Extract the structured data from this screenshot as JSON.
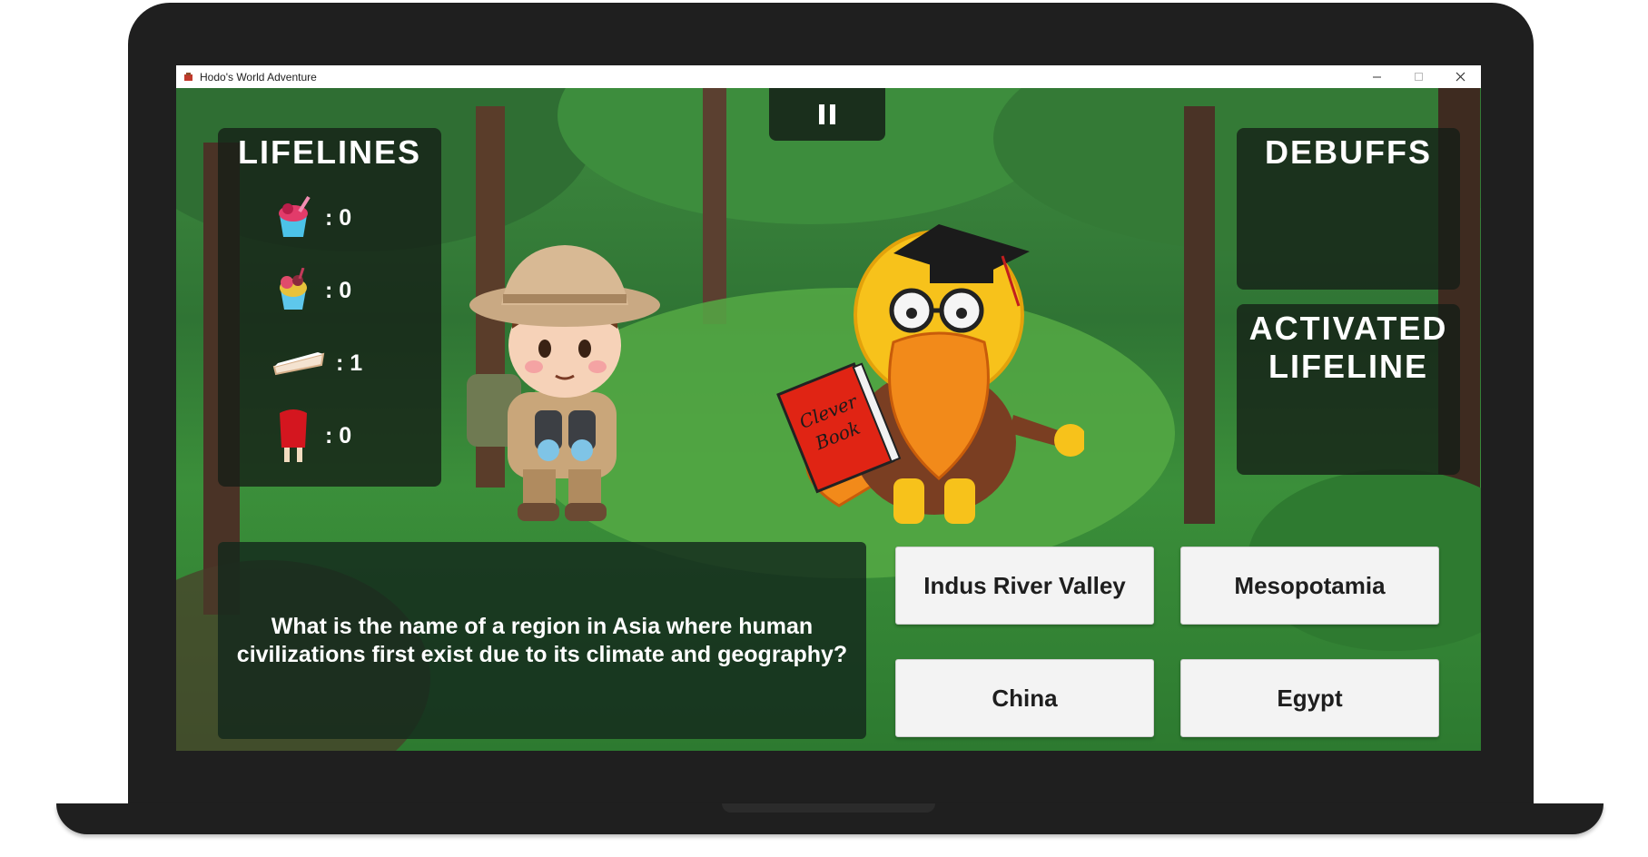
{
  "window": {
    "title": "Hodo's World Adventure",
    "controls": [
      "minimize",
      "maximize",
      "close"
    ]
  },
  "game": {
    "pause_icon": "pause-icon",
    "lifelines": {
      "title": "LIFELINES",
      "items": [
        {
          "icon": "ice-cream-cup-icon",
          "count": ": 0"
        },
        {
          "icon": "fruit-parfait-icon",
          "count": ": 0"
        },
        {
          "icon": "pie-slice-icon",
          "count": ": 1"
        },
        {
          "icon": "popsicle-icon",
          "count": ": 0"
        }
      ]
    },
    "debuffs": {
      "title": "DEBUFFS"
    },
    "activated_lifeline": {
      "title_line1": "ACTIVATED",
      "title_line2": "LIFELINE"
    },
    "characters": {
      "player": "explorer-boy-character",
      "opponent": "professor-lion-character",
      "book_text_line1": "Clever",
      "book_text_line2": "Book"
    },
    "question": "What is the name of a region in Asia where human civilizations first exist due to its climate and geography?",
    "answers": [
      "Indus River Valley",
      "Mesopotamia",
      "China",
      "Egypt"
    ]
  },
  "colors": {
    "panel_bg": "#142a1c",
    "forest_green": "#3b8f3a",
    "button_bg": "#f3f3f3"
  }
}
